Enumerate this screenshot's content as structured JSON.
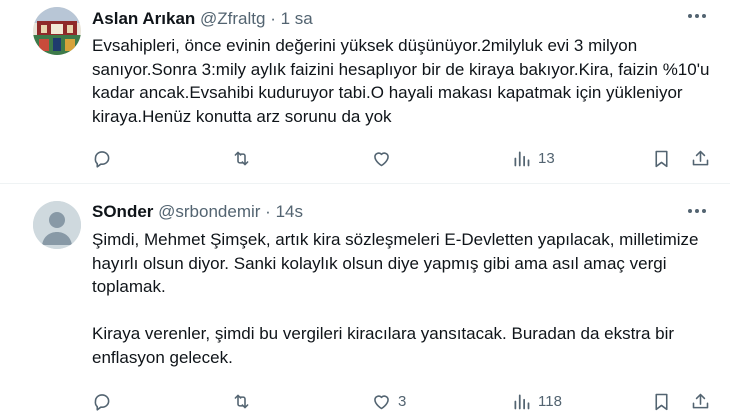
{
  "tweets": [
    {
      "name": "Aslan Arıkan",
      "handle": "@Zfraltg",
      "separator": "·",
      "time": "1 sa",
      "text": "Evsahipleri, önce evinin değerini yüksek düşünüyor.2milyluk evi 3 milyon sanıyor.Sonra 3:mily aylık faizini hesaplıyor bir de kiraya bakıyor.Kira, faizin %10'u kadar ancak.Evsahibi kuduruyor tabi.O hayali makası kapatmak için yükleniyor kiraya.Henüz konutta arz sorunu da yok",
      "counts": {
        "reply": "",
        "retweet": "",
        "like": "",
        "views": "13"
      },
      "avatar_icon": "profile-photo"
    },
    {
      "name": "SOnder",
      "handle": "@srbondemir",
      "separator": "·",
      "time": "14s",
      "paragraphs": [
        "Şimdi, Mehmet Şimşek, artık kira sözleşmeleri E-Devletten yapılacak, milletimize hayırlı olsun diyor. Sanki kolaylık olsun diye yapmış gibi ama asıl amaç vergi toplamak.",
        "Kiraya verenler, şimdi bu vergileri kiracılara yansıtacak. Buradan da ekstra bir enflasyon gelecek."
      ],
      "counts": {
        "reply": "",
        "retweet": "",
        "like": "3",
        "views": "118"
      },
      "avatar_icon": "default-avatar-icon"
    }
  ],
  "colors": {
    "text": "#0f1419",
    "secondary": "#536471",
    "divider": "#eff3f4",
    "default_avatar": "#cfd9de"
  },
  "icons": [
    "reply-icon",
    "retweet-icon",
    "like-icon",
    "views-icon",
    "bookmark-icon",
    "share-icon",
    "more-icon"
  ]
}
